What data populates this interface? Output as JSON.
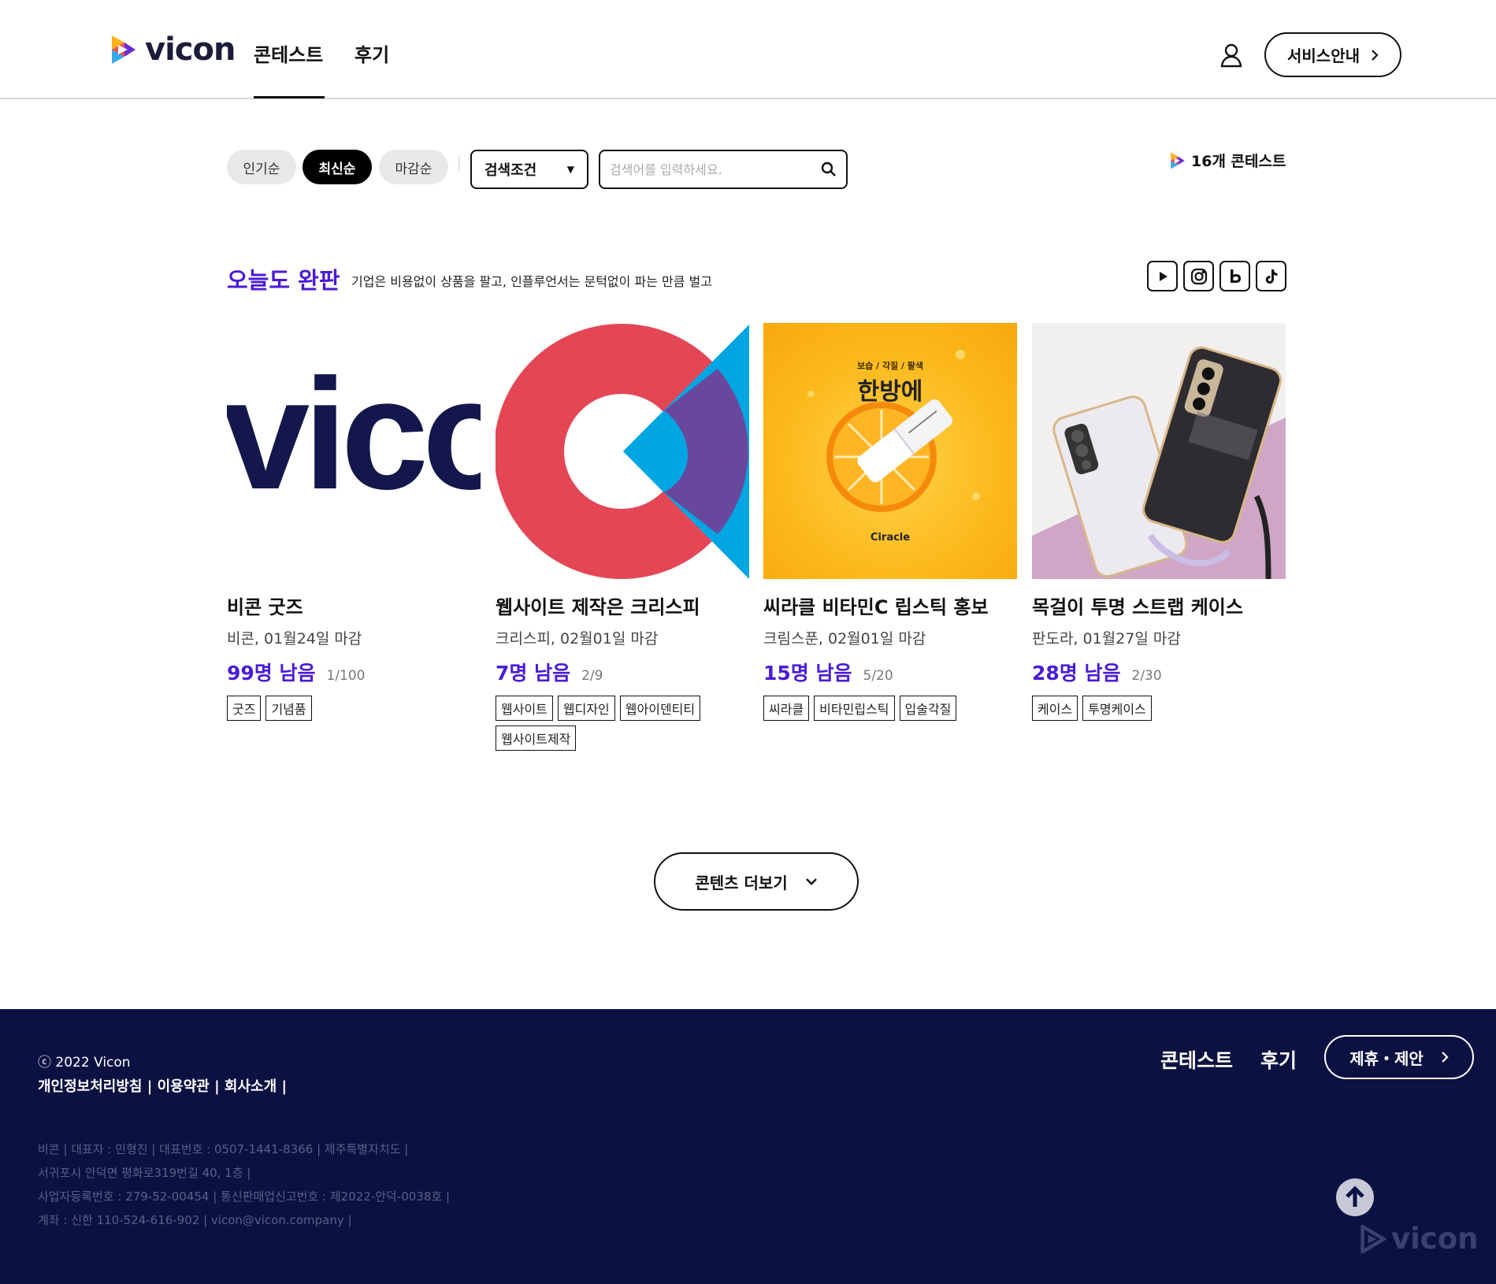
{
  "header": {
    "logo_text": "vicon",
    "nav": {
      "contest": "콘테스트",
      "review": "후기"
    },
    "service_button": "서비스안내"
  },
  "filters": {
    "popular": "인기순",
    "newest": "최신순",
    "deadline": "마감순",
    "condition_select": "검색조건",
    "search_placeholder": "검색어를 입력하세요.",
    "contest_count": "16개 콘테스트"
  },
  "section": {
    "title": "오늘도 완판",
    "subtitle": "기업은 비용없이 상품을 팔고, 인플루언서는 문턱없이 파는 만큼 벌고"
  },
  "sns_icons": [
    "youtube-icon",
    "instagram-icon",
    "blog-icon",
    "tiktok-icon"
  ],
  "cards": [
    {
      "title": "비콘 굿즈",
      "meta": "비콘, 01월24일 마감",
      "remain": "99명 남음",
      "ratio": "1/100",
      "tags": [
        "굿즈",
        "기념품"
      ],
      "thumb_text": "vico"
    },
    {
      "title": "웹사이트 제작은 크리스피",
      "meta": "크리스피, 02월01일 마감",
      "remain": "7명 남음",
      "ratio": "2/9",
      "tags": [
        "웹사이트",
        "웹디자인",
        "웹아이덴티티",
        "웹사이트제작"
      ]
    },
    {
      "title": "씨라클 비타민C 립스틱 홍보",
      "meta": "크림스푼, 02월01일 마감",
      "remain": "15명 남음",
      "ratio": "5/20",
      "tags": [
        "씨라클",
        "비타민립스틱",
        "입술각질"
      ],
      "thumb_caption_small": "보습 / 각질 / 팔색",
      "thumb_caption_big": "한방에",
      "thumb_brand": "Ciracle"
    },
    {
      "title": "목걸이 투명 스트랩 케이스",
      "meta": "판도라, 01월27일 마감",
      "remain": "28명 남음",
      "ratio": "2/30",
      "tags": [
        "케이스",
        "투명케이스"
      ]
    }
  ],
  "more_button": "콘텐츠 더보기",
  "footer": {
    "copyright": "ⓒ 2022 Vicon",
    "links": "개인정보처리방침 | 이용약관 | 회사소개 |",
    "biz_lines": [
      "비콘 | 대표자 : 민형진 | 대표번호 : 0507-1441-8366 | 제주특별자치도 |",
      "서귀포시 안덕면 평화로319번길 40, 1층 |",
      "사업자등록번호 : 279-52-00454 | 통신판매업신고번호 : 제2022-안덕-0038호 |",
      "계좌 : 신한 110-524-616-902 | vicon@vicon.company |"
    ],
    "nav": {
      "contest": "콘테스트",
      "review": "후기"
    },
    "partner_button": "제휴・제안",
    "logo_text": "vicon"
  }
}
